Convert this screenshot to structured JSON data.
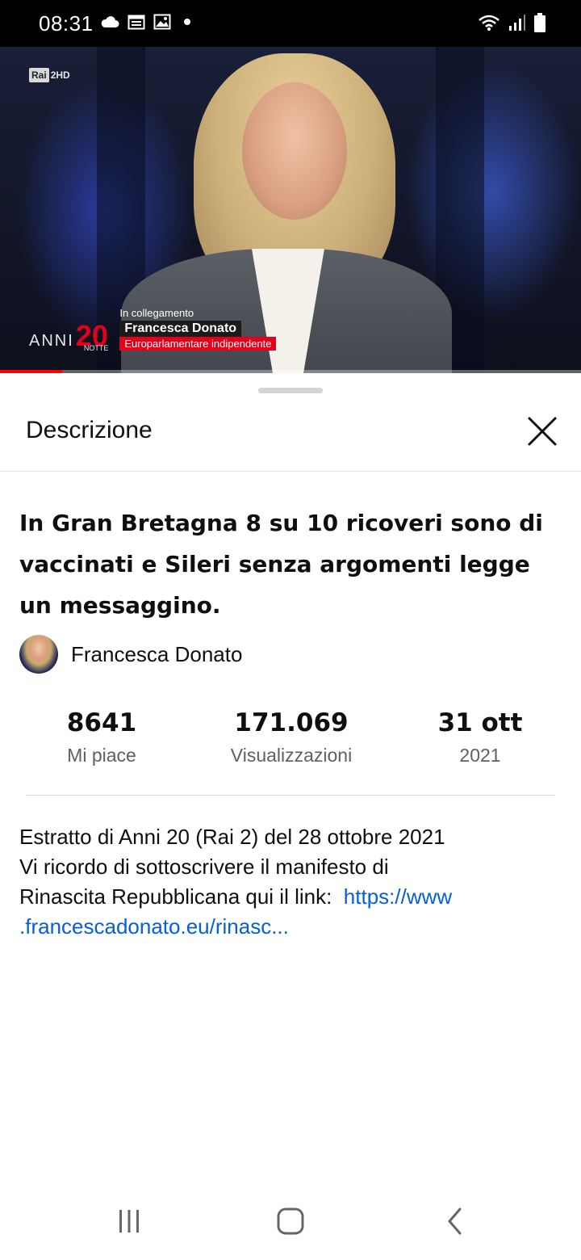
{
  "status_bar": {
    "time": "08:31",
    "icons_left": [
      "cloud-icon",
      "calendar-icon",
      "gallery-icon",
      "dot-icon"
    ],
    "icons_right": [
      "wifi-icon",
      "signal-icon",
      "battery-icon"
    ]
  },
  "video": {
    "channel_logo": "Rai",
    "channel_suffix": "2HD",
    "show_name": "ANNI",
    "show_number": "20",
    "show_sub": "NOTTE",
    "caption_small": "In collegamento",
    "caption_name": "Francesca Donato",
    "caption_role": "Europarlamentare indipendente",
    "progress_fraction": 0.107,
    "progress_color": "#ff0000"
  },
  "sheet": {
    "title": "Descrizione",
    "close_icon": "close-icon"
  },
  "video_info": {
    "title": "In Gran Bretagna 8 su 10 ricoveri sono di vaccinati e Sileri senza argomenti legge un messaggino.",
    "channel_name": "Francesca Donato"
  },
  "stats": [
    {
      "value": "8641",
      "label": "Mi piace"
    },
    {
      "value": "171.069",
      "label": "Visualizzazioni"
    },
    {
      "value": "31 ott",
      "label": "2021"
    }
  ],
  "description": {
    "line1": "Estratto di Anni 20 (Rai 2) del 28 ottobre 2021",
    "line2": "Vi ricordo di sottoscrivere il manifesto di",
    "line3": "Rinascita Repubblicana qui il link:  ",
    "link_part1": "https://www",
    "link_part2": ".francescadonato.eu/rinasc..."
  },
  "nav_bar": {
    "icons": [
      "recent-apps-icon",
      "home-icon",
      "back-icon"
    ]
  }
}
